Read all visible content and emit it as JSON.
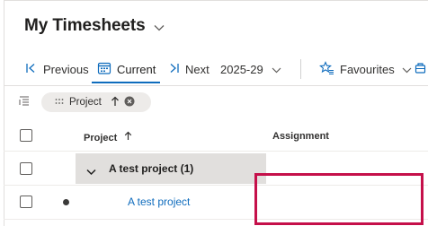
{
  "header": {
    "title": "My Timesheets"
  },
  "toolbar": {
    "previous_label": "Previous",
    "current_label": "Current",
    "next_label": "Next",
    "week_value": "2025-29",
    "favourites_label": "Favourites"
  },
  "filter": {
    "chip_label": "Project"
  },
  "grid": {
    "columns": [
      "Project",
      "Assignment"
    ],
    "group": {
      "label": "A test project (1)"
    },
    "rows": [
      {
        "project": "A test project",
        "assignment": ""
      }
    ]
  },
  "colors": {
    "accent": "#0f6cbd",
    "highlight": "#c5104a"
  },
  "icons": [
    "chevron-down-icon",
    "previous-icon",
    "calendar-icon",
    "next-icon",
    "favourites-icon",
    "group-by-icon",
    "sort-up-icon",
    "dismiss-icon"
  ]
}
